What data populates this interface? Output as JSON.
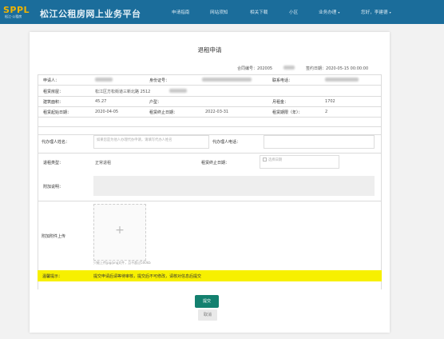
{
  "header": {
    "logo_text": "SPPL",
    "logo_subtext": "松江·公租房",
    "site_title": "松江公租房网上业务平台",
    "nav": [
      "申请指南",
      "网站须知",
      "相关下载",
      "小区",
      "业务办理",
      "您好，李建德"
    ]
  },
  "form": {
    "title": "退租申请",
    "contract_no_label": "合同编号：",
    "contract_no_value": "202005",
    "sign_date_label": "签约日期：",
    "sign_date_value": "2020-05-15 00:00:00",
    "rows": {
      "applicant_label": "申请人：",
      "id_label": "身份证号：",
      "phone_label": "联系电话：",
      "address_label": "租赁房屋：",
      "address_value": "松江区方松街道三新北路 2512",
      "area_label": "建筑面积：",
      "area_value": "45.27",
      "layout_label": "户型：",
      "rent_label": "月租金：",
      "rent_value": "1702",
      "start_label": "租赁起始日期：",
      "start_value": "2020-04-05",
      "end_label": "租赁终止日期：",
      "end_value": "2022-03-31",
      "months_label": "租赁期限（年）：",
      "months_value": "2"
    },
    "agent_name_label": "代办理人姓名：",
    "agent_name_placeholder": "如果您是为他人办理代办申请，请填写代办人姓名",
    "agent_phone_label": "代办理人电话：",
    "type_label": "退租类型：",
    "type_value": "正常退租",
    "end_date_label": "租赁终止日期：",
    "end_date_placeholder": "选择日期",
    "desc_label": "附加说明：",
    "upload_label": "附加附件上传",
    "upload_hint": "只能上传jpg/png文件，且不超过500kb",
    "warn_label": "温馨提示：",
    "warn_text": "提交申请后请等待审核，提交后不可修改，请核对信息后提交",
    "submit_label": "提交",
    "cancel_label": "取消"
  }
}
